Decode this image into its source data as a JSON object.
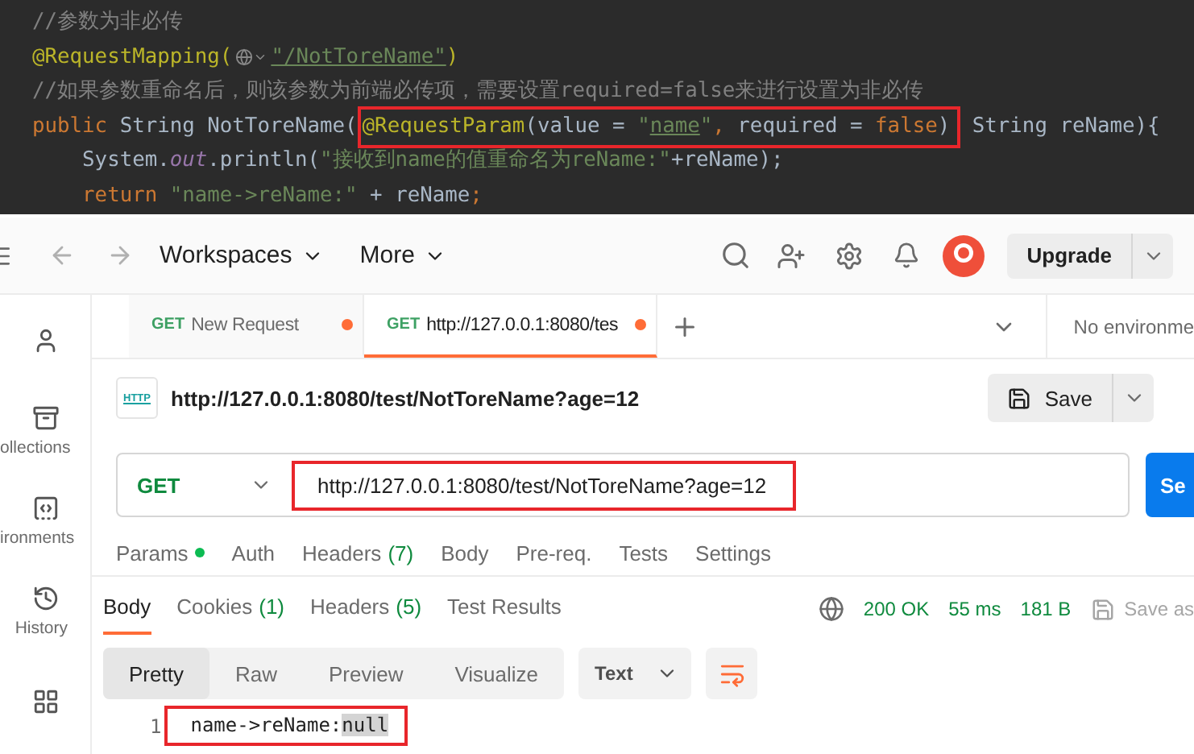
{
  "code_editor": {
    "lines": [
      {
        "segments": [
          {
            "kind": "comment",
            "text": "//参数为非必传"
          }
        ]
      },
      {
        "segments": [
          {
            "kind": "annotation",
            "text": "@RequestMapping("
          },
          {
            "kind": "route_icon"
          },
          {
            "kind": "link",
            "text": "\"/NotToreName\""
          },
          {
            "kind": "annotation",
            "text": ")"
          }
        ]
      },
      {
        "segments": [
          {
            "kind": "comment",
            "text": "//如果参数重命名后，则该参数为前端必传项，需要设置required=false来进行设置为非必传"
          }
        ]
      },
      {
        "segments": [
          {
            "kind": "keyword",
            "text": "public "
          },
          {
            "kind": "plain",
            "text": "String NotToreName("
          },
          {
            "kind": "boxed",
            "parts": [
              {
                "kind": "annotation",
                "text": "@RequestParam"
              },
              {
                "kind": "plain",
                "text": "(value = "
              },
              {
                "kind": "string",
                "text": "\""
              },
              {
                "kind": "link",
                "text": "name"
              },
              {
                "kind": "string",
                "text": "\""
              },
              {
                "kind": "keyword",
                "text": ", "
              },
              {
                "kind": "plain",
                "text": "required = "
              },
              {
                "kind": "keyword",
                "text": "false"
              },
              {
                "kind": "plain",
                "text": ")"
              }
            ]
          },
          {
            "kind": "plain",
            "text": " String reName){"
          }
        ]
      },
      {
        "segments": [
          {
            "kind": "plain",
            "text": "    System."
          },
          {
            "kind": "field",
            "text": "out"
          },
          {
            "kind": "plain",
            "text": ".println("
          },
          {
            "kind": "string",
            "text": "\"接收到name的值重命名为reName:\""
          },
          {
            "kind": "plain",
            "text": "+reName);"
          }
        ]
      },
      {
        "segments": [
          {
            "kind": "keyword",
            "text": "    return "
          },
          {
            "kind": "string",
            "text": "\"name->reName:\""
          },
          {
            "kind": "plain",
            "text": " + reName"
          },
          {
            "kind": "keyword",
            "text": ";"
          }
        ]
      }
    ]
  },
  "topbar": {
    "menus": [
      "Workspaces",
      "More"
    ],
    "upgrade": "Upgrade"
  },
  "sidebar": {
    "items": [
      {
        "kind": "user"
      },
      {
        "kind": "collections",
        "label": "ollections"
      },
      {
        "kind": "environments",
        "label": "ironments"
      },
      {
        "kind": "history",
        "label": "History"
      },
      {
        "kind": "add"
      }
    ]
  },
  "tabs": [
    {
      "method": "GET",
      "label": "New Request",
      "unsaved": true,
      "selected": false
    },
    {
      "method": "GET",
      "label": "http://127.0.0.1:8080/tes",
      "unsaved": true,
      "selected": true
    }
  ],
  "environment": "No environme",
  "request": {
    "icon_text": "HTTP",
    "title": "http://127.0.0.1:8080/test/NotToreName?age=12",
    "save": "Save",
    "method": "GET",
    "url": "http://127.0.0.1:8080/test/NotToreName?age=12",
    "url_highlighted": true,
    "send": "Se"
  },
  "request_tabs": [
    {
      "label": "Params",
      "indicator": true
    },
    {
      "label": "Auth",
      "indicator": false
    },
    {
      "label": "Headers",
      "count": "(7)",
      "indicator": false
    },
    {
      "label": "Body",
      "indicator": false
    },
    {
      "label": "Pre-req.",
      "indicator": false
    },
    {
      "label": "Tests",
      "indicator": false
    },
    {
      "label": "Settings",
      "indicator": false
    }
  ],
  "response_tabs": [
    {
      "label": "Body",
      "selected": true
    },
    {
      "label": "Cookies",
      "count": "(1)",
      "selected": false
    },
    {
      "label": "Headers",
      "count": "(5)",
      "selected": false
    },
    {
      "label": "Test Results",
      "selected": false
    }
  ],
  "response_status": {
    "status": "200 OK",
    "time": "55 ms",
    "size": "181 B",
    "save_as": "Save as"
  },
  "view_tabs": [
    {
      "label": "Pretty",
      "selected": true
    },
    {
      "label": "Raw",
      "selected": false
    },
    {
      "label": "Preview",
      "selected": false
    },
    {
      "label": "Visualize",
      "selected": false
    }
  ],
  "format": "Text",
  "response_body": {
    "line_number": "1",
    "text": "name->reName:",
    "selected_text": "null",
    "highlighted": true
  }
}
